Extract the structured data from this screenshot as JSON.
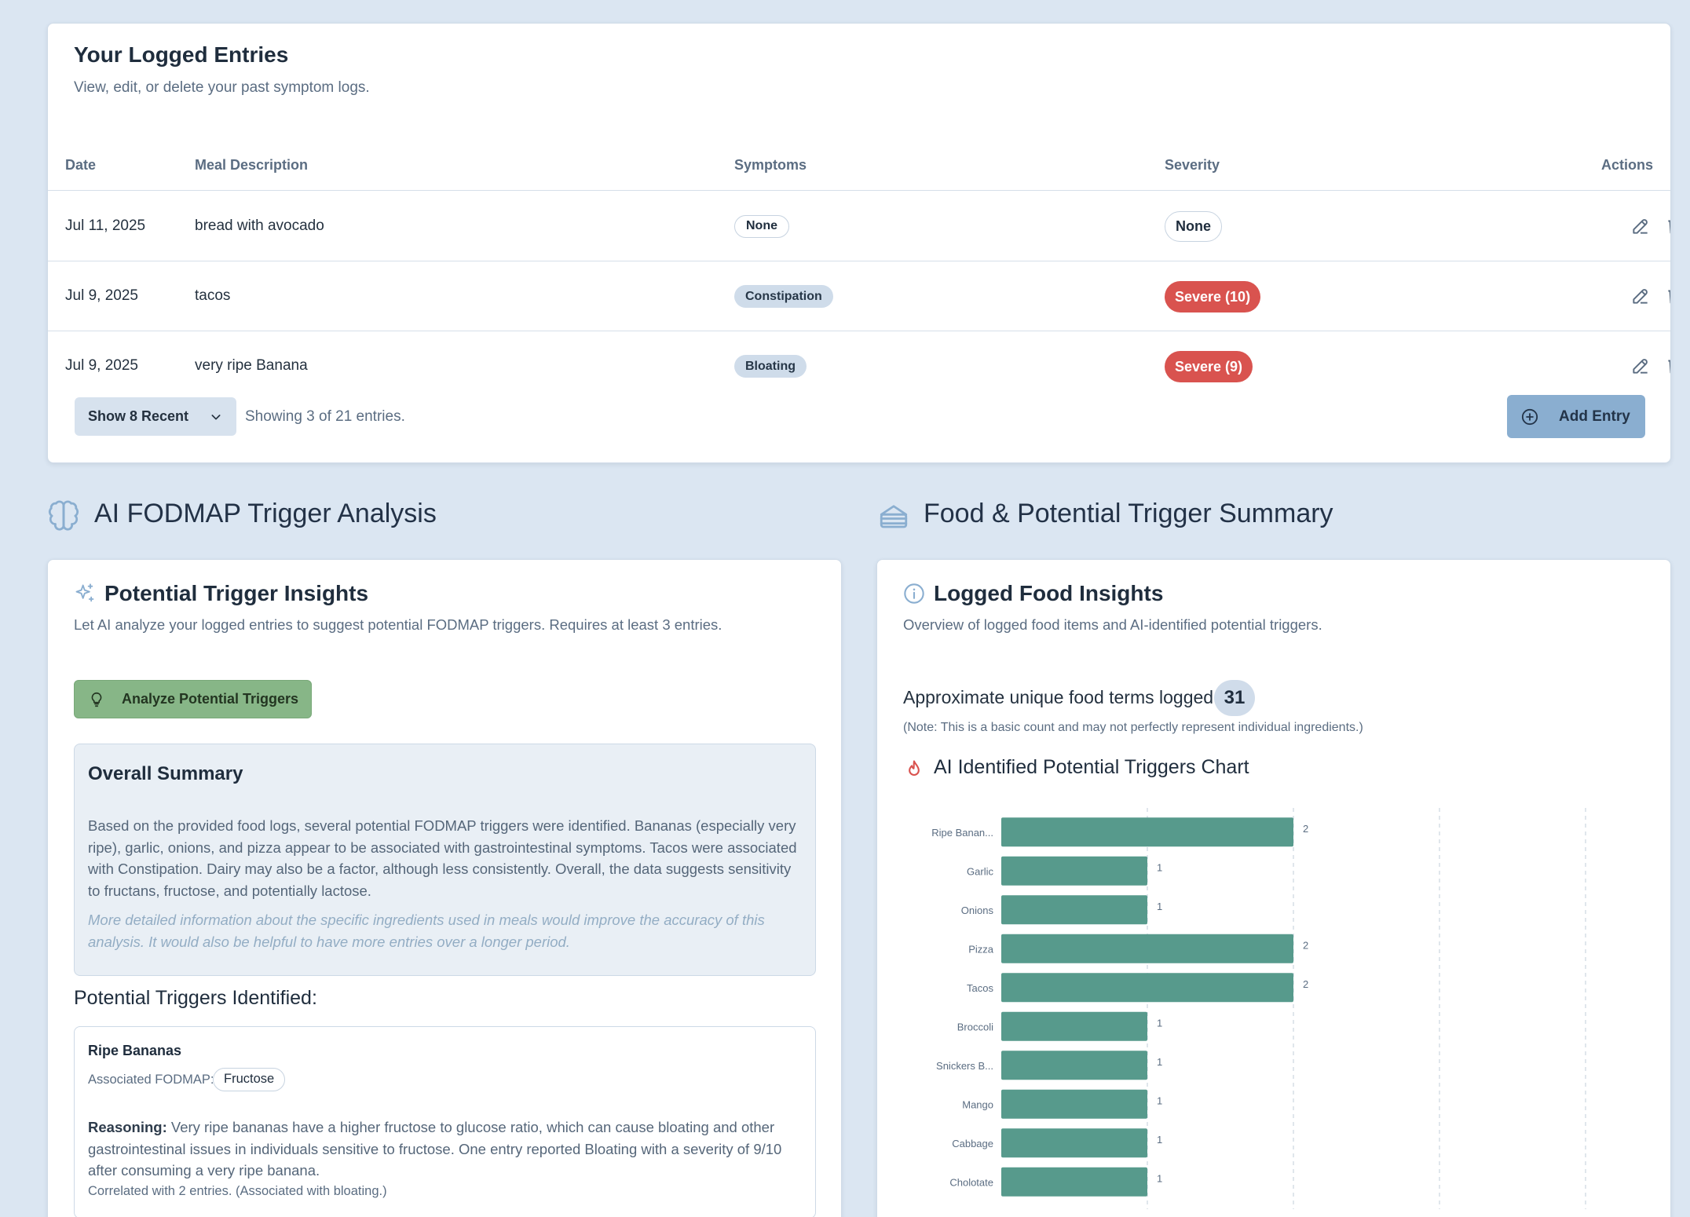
{
  "entries": {
    "title": "Your Logged Entries",
    "subtitle": "View, edit, or delete your past symptom logs.",
    "columns": {
      "date": "Date",
      "meal": "Meal Description",
      "symptoms": "Symptoms",
      "severity": "Severity",
      "actions": "Actions"
    },
    "rows": [
      {
        "date": "Jul 11, 2025",
        "meal": "bread with avocado",
        "symptom": "None",
        "severity": "None",
        "severity_level": "none"
      },
      {
        "date": "Jul 9, 2025",
        "meal": "tacos",
        "symptom": "Constipation",
        "severity": "Severe (10)",
        "severity_level": "severe"
      },
      {
        "date": "Jul 9, 2025",
        "meal": "very ripe Banana",
        "symptom": "Bloating",
        "severity": "Severe (9)",
        "severity_level": "severe"
      }
    ],
    "show_select": "Show 8 Recent",
    "showing_text": "Showing 3 of 21 entries.",
    "add_label": "Add Entry"
  },
  "analysis": {
    "heading": "AI FODMAP Trigger Analysis",
    "card_title": "Potential Trigger Insights",
    "card_subtitle": "Let AI analyze your logged entries to suggest potential FODMAP triggers. Requires at least 3 entries.",
    "analyze_label": "Analyze Potential Triggers",
    "summary_title": "Overall Summary",
    "summary_text": "Based on the provided food logs, several potential FODMAP triggers were identified. Bananas (especially very ripe), garlic, onions, and pizza appear to be associated with gastrointestinal symptoms. Tacos were associated with Constipation. Dairy may also be a factor, although less consistently. Overall, the data suggests sensitivity to fructans, fructose, and potentially lactose.",
    "summary_note": "More detailed information about the specific ingredients used in meals would improve the accuracy of this analysis. It would also be helpful to have more entries over a longer period.",
    "triggers_title": "Potential Triggers Identified:",
    "trigger": {
      "name": "Ripe Bananas",
      "assoc_label": "Associated FODMAP:",
      "fodmap": "Fructose",
      "reason_label": "Reasoning:",
      "reason_text": " Very ripe bananas have a higher fructose to glucose ratio, which can cause bloating and other gastrointestinal issues in individuals sensitive to fructose. One entry reported Bloating with a severity of 9/10 after consuming a very ripe banana.",
      "correlation": "Correlated with 2 entries. (Associated with bloating.)"
    }
  },
  "summary": {
    "heading": "Food & Potential Trigger Summary",
    "card_title": "Logged Food Insights",
    "card_subtitle": "Overview of logged food items and AI-identified potential triggers.",
    "count_label": "Approximate unique food terms logged:",
    "count": "31",
    "note": "(Note: This is a basic count and may not perfectly represent individual ingredients.)",
    "chart_title": "AI Identified Potential Triggers Chart"
  },
  "colors": {
    "bar": "#579a8c",
    "severe": "#d9534f",
    "analyze": "#87b687",
    "add": "#8aaed0"
  },
  "chart_data": {
    "type": "bar",
    "orientation": "horizontal",
    "title": "AI Identified Potential Triggers Chart",
    "categories": [
      "Ripe Banan...",
      "Garlic",
      "Onions",
      "Pizza",
      "Tacos",
      "Broccoli",
      "Snickers B...",
      "Mango",
      "Cabbage",
      "Cholotate"
    ],
    "values": [
      2,
      1,
      1,
      2,
      2,
      1,
      1,
      1,
      1,
      1
    ],
    "xticks": [
      "0",
      "1",
      "2",
      "3",
      "4"
    ],
    "xlim": [
      0,
      4
    ],
    "grid": "vertical dashed"
  }
}
